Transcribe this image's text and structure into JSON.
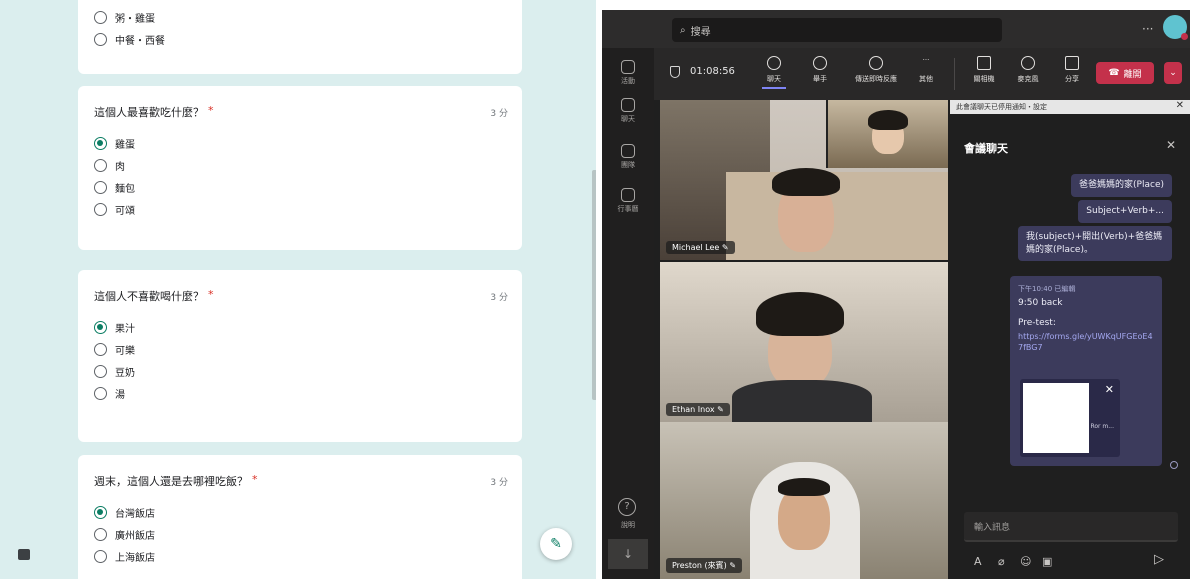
{
  "form": {
    "q1_tail": {
      "options": [
        {
          "label": "粥・雞蛋",
          "selected": false
        },
        {
          "label": "中餐・西餐",
          "selected": false
        }
      ]
    },
    "questions": [
      {
        "title": "這個人最喜歡吃什麼？",
        "required": "*",
        "points": "3 分",
        "options": [
          {
            "label": "雞蛋",
            "selected": true
          },
          {
            "label": "肉",
            "selected": false
          },
          {
            "label": "麵包",
            "selected": false
          },
          {
            "label": "可頌",
            "selected": false
          }
        ]
      },
      {
        "title": "這個人不喜歡喝什麼？",
        "required": "*",
        "points": "3 分",
        "options": [
          {
            "label": "果汁",
            "selected": true
          },
          {
            "label": "可樂",
            "selected": false
          },
          {
            "label": "豆奶",
            "selected": false
          },
          {
            "label": "湯",
            "selected": false
          }
        ]
      },
      {
        "title": "週末，這個人還是去哪裡吃飯？",
        "required": "*",
        "points": "3 分",
        "options": [
          {
            "label": "台灣飯店",
            "selected": true
          },
          {
            "label": "廣州飯店",
            "selected": false
          },
          {
            "label": "上海飯店",
            "selected": false
          }
        ]
      }
    ],
    "accent_color": "#0b7d63"
  },
  "teams": {
    "search_placeholder": "搜尋",
    "more_label": "···",
    "rail": [
      {
        "label": "活動",
        "icon": "bell-icon"
      },
      {
        "label": "聊天",
        "icon": "chat-icon"
      },
      {
        "label": "團隊",
        "icon": "teams-icon"
      },
      {
        "label": "行事曆",
        "icon": "calendar-icon"
      }
    ],
    "help_label": "說明",
    "help_glyph": "?",
    "download_glyph": "↓",
    "meeting": {
      "timer": "01:08:56",
      "buttons": [
        {
          "label": "聊天",
          "icon": "chat-icon",
          "active": true
        },
        {
          "label": "舉手",
          "icon": "raise-hand-icon",
          "active": false
        },
        {
          "label": "傳送即時反應",
          "icon": "emoji-icon",
          "active": false
        },
        {
          "label": "其他",
          "icon": "more-icon",
          "active": false
        }
      ],
      "device_buttons": [
        {
          "label": "關相機",
          "icon": "camera-icon"
        },
        {
          "label": "麥克風",
          "icon": "mic-icon"
        },
        {
          "label": "分享",
          "icon": "share-icon"
        }
      ],
      "leave_label": "離開",
      "leave_color": "#c4314b"
    },
    "participants": [
      {
        "name": "Michael Lee"
      },
      {
        "name": "Ethan Inox"
      },
      {
        "name": "Preston (來賓)"
      }
    ],
    "chat": {
      "notice": "此會議聊天已停用通知・設定",
      "notice_close": "✕",
      "title": "會議聊天",
      "close_glyph": "✕",
      "bubbles": [
        "爸爸媽媽的家(Place)",
        "Subject+Verb+...",
        "我(subject)+開出(Verb)+爸爸媽媽的家(Place)。"
      ],
      "message": {
        "meta": "下午10:40 已編輯",
        "line1": "9:50 back",
        "line2": "Pre-test:",
        "link": "https://forms.gle/yUWKqUFGEoE47fBG7",
        "attachment_label": "Ror m...",
        "attachment_close": "✕"
      },
      "input_placeholder": "輸入訊息",
      "send_glyph": "▷"
    }
  }
}
